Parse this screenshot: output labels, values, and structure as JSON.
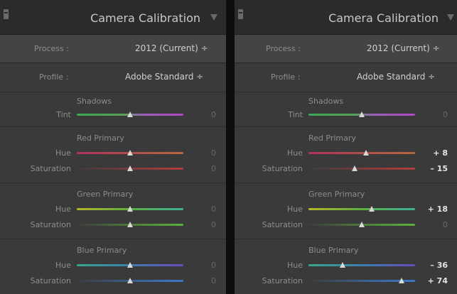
{
  "panels": [
    {
      "title": "Camera Calibration",
      "process": {
        "label": "Process :",
        "value": "2012 (Current) ÷"
      },
      "profile": {
        "label": "Profile :",
        "value": "Adobe Standard ÷"
      },
      "groups": [
        {
          "title": "Shadows",
          "rows": [
            {
              "label": "Tint",
              "value": "0",
              "level": 0.5,
              "changed": false,
              "gradient": "linear-gradient(90deg,#3aa852,#58a05a 45%,#9a62b8 60%,#b247c4)"
            }
          ]
        },
        {
          "title": "Red Primary",
          "rows": [
            {
              "label": "Hue",
              "value": "0",
              "level": 0.5,
              "changed": false,
              "gradient": "linear-gradient(90deg,#b2335e,#b04d4d 50%,#b7683f)"
            },
            {
              "label": "Saturation",
              "value": "0",
              "level": 0.5,
              "changed": false,
              "gradient": "linear-gradient(90deg,#3c3c3c,#7a3c3c 50%,#b43c3c)"
            }
          ]
        },
        {
          "title": "Green Primary",
          "rows": [
            {
              "label": "Hue",
              "value": "0",
              "level": 0.5,
              "changed": false,
              "gradient": "linear-gradient(90deg,#b8b52c,#5cb03e 50%,#3cb09a)"
            },
            {
              "label": "Saturation",
              "value": "0",
              "level": 0.5,
              "changed": false,
              "gradient": "linear-gradient(90deg,#3c3c3c,#4f7a3c 50%,#5cb03e)"
            }
          ]
        },
        {
          "title": "Blue Primary",
          "rows": [
            {
              "label": "Hue",
              "value": "0",
              "level": 0.5,
              "changed": false,
              "gradient": "linear-gradient(90deg,#35a88a,#3a7fb0 50%,#6a4bc0)"
            },
            {
              "label": "Saturation",
              "value": "0",
              "level": 0.5,
              "changed": false,
              "gradient": "linear-gradient(90deg,#3c3c3c,#3c5f8a 50%,#3c78c8)"
            }
          ]
        }
      ]
    },
    {
      "title": "Camera Calibration",
      "process": {
        "label": "Process :",
        "value": "2012 (Current) ÷"
      },
      "profile": {
        "label": "Profile :",
        "value": "Adobe Standard ÷"
      },
      "groups": [
        {
          "title": "Shadows",
          "rows": [
            {
              "label": "Tint",
              "value": "0",
              "level": 0.5,
              "changed": false,
              "gradient": "linear-gradient(90deg,#3aa852,#58a05a 45%,#9a62b8 60%,#b247c4)"
            }
          ]
        },
        {
          "title": "Red Primary",
          "rows": [
            {
              "label": "Hue",
              "value": "+ 8",
              "level": 0.54,
              "changed": true,
              "gradient": "linear-gradient(90deg,#b2335e,#b04d4d 50%,#b7683f)"
            },
            {
              "label": "Saturation",
              "value": "– 15",
              "level": 0.43,
              "changed": true,
              "gradient": "linear-gradient(90deg,#3c3c3c,#7a3c3c 50%,#b43c3c)"
            }
          ]
        },
        {
          "title": "Green Primary",
          "rows": [
            {
              "label": "Hue",
              "value": "+ 18",
              "level": 0.59,
              "changed": true,
              "gradient": "linear-gradient(90deg,#b8b52c,#5cb03e 50%,#3cb09a)"
            },
            {
              "label": "Saturation",
              "value": "0",
              "level": 0.5,
              "changed": false,
              "gradient": "linear-gradient(90deg,#3c3c3c,#4f7a3c 50%,#5cb03e)"
            }
          ]
        },
        {
          "title": "Blue Primary",
          "rows": [
            {
              "label": "Hue",
              "value": "– 36",
              "level": 0.32,
              "changed": true,
              "gradient": "linear-gradient(90deg,#35a88a,#3a7fb0 50%,#6a4bc0)"
            },
            {
              "label": "Saturation",
              "value": "+ 74",
              "level": 0.87,
              "changed": true,
              "gradient": "linear-gradient(90deg,#3c3c3c,#3c5f8a 50%,#3c78c8)"
            }
          ]
        }
      ]
    }
  ]
}
